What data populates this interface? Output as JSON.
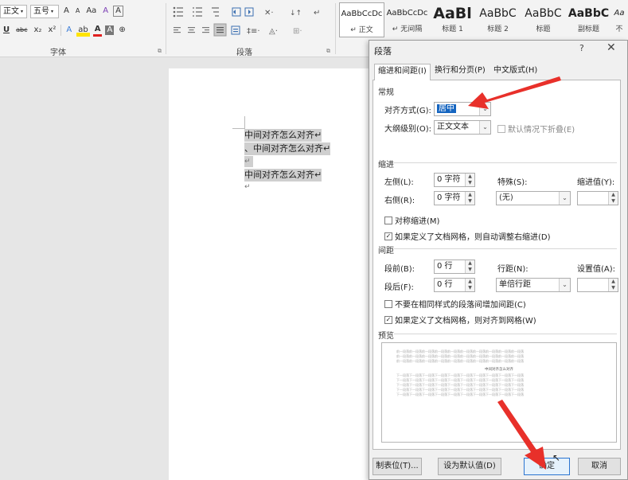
{
  "ribbon": {
    "font_group": {
      "style_combo": "正文",
      "size_combo": "五号",
      "row1_buttons": [
        "A",
        "A",
        "Aa",
        "A",
        "A"
      ],
      "row2_buttons": [
        "U",
        "abc",
        "x₂",
        "x²",
        "A",
        "ab",
        "A",
        "A",
        "⊕"
      ],
      "label": "字体"
    },
    "paragraph_group": {
      "label": "段落"
    },
    "styles": [
      {
        "preview": "AaBbCcDc",
        "name": "↵ 正文",
        "selected": true
      },
      {
        "preview": "AaBbCcDc",
        "name": "↵ 无间隔",
        "selected": false
      },
      {
        "preview": "AaBl",
        "name": "标题 1",
        "selected": false
      },
      {
        "preview": "AaBbC",
        "name": "标题 2",
        "selected": false
      },
      {
        "preview": "AaBbC",
        "name": "标题",
        "selected": false
      },
      {
        "preview": "AaBbC",
        "name": "副标题",
        "selected": false
      },
      {
        "preview": "Aa",
        "name": "不",
        "selected": false
      }
    ]
  },
  "document": {
    "lines": [
      "中间对齐怎么对齐↵",
      "、中间对齐怎么对齐↵",
      "↵",
      "中间对齐怎么对齐↵"
    ],
    "trailing_mark": "↵"
  },
  "dialog": {
    "title": "段落",
    "help": "?",
    "close": "✕",
    "tabs": [
      "缩进和间距(I)",
      "换行和分页(P)",
      "中文版式(H)"
    ],
    "general": {
      "heading": "常规",
      "alignment_label": "对齐方式(G):",
      "alignment_value": "居中",
      "outline_label": "大纲级别(O):",
      "outline_value": "正文文本",
      "collapse_label": "默认情况下折叠(E)"
    },
    "indent": {
      "heading": "缩进",
      "left_label": "左侧(L):",
      "left_value": "0 字符",
      "right_label": "右侧(R):",
      "right_value": "0 字符",
      "special_label": "特殊(S):",
      "special_value": "(无)",
      "indent_value_label": "缩进值(Y):",
      "mirror_label": "对称缩进(M)",
      "auto_adjust_label": "如果定义了文档网格，则自动调整右缩进(D)"
    },
    "spacing": {
      "heading": "间距",
      "before_label": "段前(B):",
      "before_value": "0 行",
      "after_label": "段后(F):",
      "after_value": "0 行",
      "line_spacing_label": "行距(N):",
      "line_spacing_value": "单倍行距",
      "setting_label": "设置值(A):",
      "no_space_label": "不要在相同样式的段落间增加间距(C)",
      "snap_grid_label": "如果定义了文档网格，则对齐到网格(W)"
    },
    "preview": {
      "heading": "预览",
      "prev_text": "前一段落前一段落前一段落前一段落前一段落前一段落前一段落前一段落前一段落前一段落",
      "center_text": "中间对齐怎么对齐",
      "next_text": "下一段落下一段落下一段落下一段落下一段落下一段落下一段落下一段落下一段落下一段落"
    },
    "buttons": {
      "tabs": "制表位(T)...",
      "default": "设为默认值(D)",
      "ok": "确定",
      "cancel": "取消"
    }
  },
  "colors": {
    "arrow": "#e8302a",
    "selection": "#1565c0"
  }
}
